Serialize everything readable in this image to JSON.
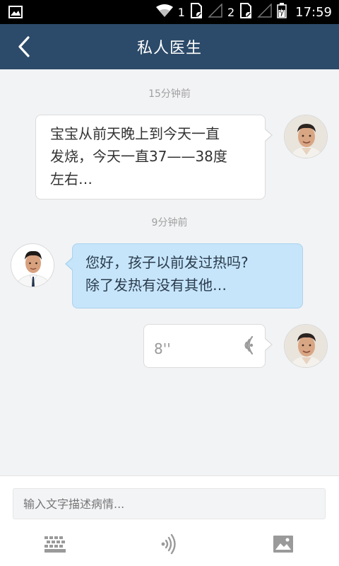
{
  "status_bar": {
    "sim1": "1",
    "sim2": "2",
    "time": "17:59"
  },
  "nav": {
    "title": "私人医生",
    "back_icon": "chevron-left-icon"
  },
  "messages": [
    {
      "type": "timestamp",
      "text": "15分钟前"
    },
    {
      "type": "text",
      "side": "right",
      "sender": "patient",
      "lines": [
        "宝宝从前天晚上到今天一直",
        "发烧，今天一直37——38度",
        "左右…"
      ]
    },
    {
      "type": "timestamp",
      "text": "9分钟前"
    },
    {
      "type": "text",
      "side": "left",
      "sender": "doctor",
      "lines": [
        "您好，孩子以前发过热吗?",
        "除了发热有没有其他…"
      ]
    },
    {
      "type": "voice",
      "side": "right",
      "sender": "patient",
      "duration": "8''"
    }
  ],
  "input": {
    "placeholder": "输入文字描述病情..."
  },
  "toolbar": {
    "keyboard_icon": "keyboard-icon",
    "voice_icon": "voice-icon",
    "image_icon": "image-icon"
  },
  "colors": {
    "nav_bg": "#2c4a69",
    "chat_bg": "#f2f3f5",
    "doctor_bubble": "#c6e5fa",
    "patient_bubble": "#ffffff"
  }
}
